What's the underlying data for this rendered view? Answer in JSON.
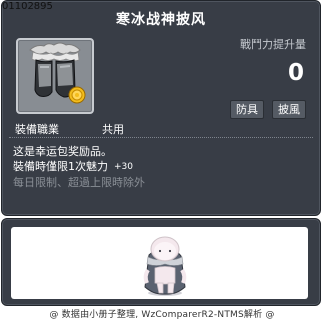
{
  "item": {
    "id": "01102895",
    "name": "寒冰战神披风",
    "attack_label": "戰鬥力提升量",
    "attack_value": "0",
    "tags": [
      "防具",
      "披風"
    ],
    "job_label": "裝備職業",
    "job_value": "共用",
    "description": [
      "这是幸运包奖励品。",
      "裝備時僅限1次魅力",
      "每日限制、超過上限時除外"
    ],
    "bonus": "+30"
  },
  "icon": {
    "item": "white-fur-cape-icon",
    "badge": "gold-coin-badge-icon"
  },
  "preview": {
    "character": "character-wearing-cape-icon"
  },
  "footer": {
    "text": "@ 数据由小册子整理, WzComparerR2-NTMS解析 @"
  },
  "colors": {
    "panel_bg": "#383d46",
    "text_primary": "#ffffff",
    "text_muted": "#8a8f96",
    "icon_bg": "#888d93",
    "coin": "#f3bd1d"
  }
}
